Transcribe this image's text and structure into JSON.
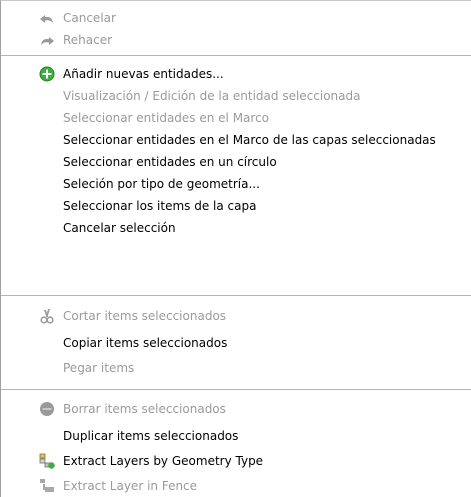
{
  "menu": {
    "items": [
      {
        "label": "Cancelar",
        "enabled": false,
        "icon": "undo-icon"
      },
      {
        "label": "Rehacer",
        "enabled": false,
        "icon": "redo-icon"
      },
      {
        "label": "Añadir nuevas entidades...",
        "enabled": true,
        "icon": "add-icon"
      },
      {
        "label": "Visualización / Edición de la entidad seleccionada",
        "enabled": false
      },
      {
        "label": "Seleccionar entidades en el Marco",
        "enabled": false
      },
      {
        "label": "Seleccionar entidades en el Marco de las capas seleccionadas",
        "enabled": true
      },
      {
        "label": "Seleccionar entidades en un círculo",
        "enabled": true
      },
      {
        "label": "Seleción por tipo de geometría...",
        "enabled": true
      },
      {
        "label": "Seleccionar los items de la capa",
        "enabled": true
      },
      {
        "label": "Cancelar selección",
        "enabled": true
      },
      {
        "label": "Cortar items seleccionados",
        "enabled": false,
        "icon": "cut-icon"
      },
      {
        "label": "Copiar items seleccionados",
        "enabled": true
      },
      {
        "label": "Pegar items",
        "enabled": false
      },
      {
        "label": "Borrar items seleccionados",
        "enabled": false,
        "icon": "delete-icon"
      },
      {
        "label": "Duplicar items seleccionados",
        "enabled": true
      },
      {
        "label": "Extract Layers by Geometry Type",
        "enabled": true,
        "icon": "extract-layers-icon"
      },
      {
        "label": "Extract Layer in Fence",
        "enabled": false,
        "icon": "extract-fence-icon"
      }
    ]
  }
}
